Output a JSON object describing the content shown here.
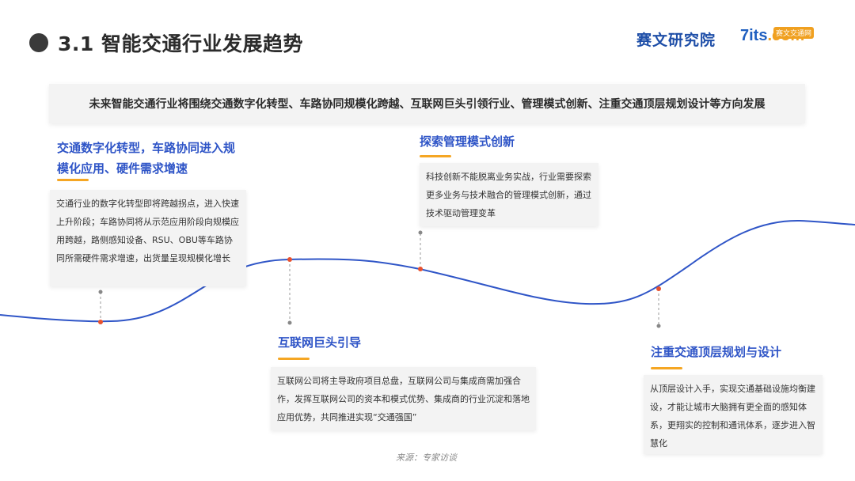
{
  "header": {
    "title": "3.1  智能交通行业发展趋势",
    "logo_left": "赛文研究院",
    "logo_right_main": "7its",
    "logo_right_suffix": ".com",
    "logo_right_badge": "赛文交通网"
  },
  "banner": "未来智能交通行业将围绕交通数字化转型、车路协同规模化跨越、互联网巨头引领行业、管理模式创新、注重交通顶层规划设计等方向发展",
  "trends": [
    {
      "title_line1": "交通数字化转型，车路协同进入规",
      "title_line2": "模化应用、硬件需求增速",
      "body": "交通行业的数字化转型即将跨越拐点，进入快速上升阶段；车路协同将从示范应用阶段向规模应用跨越，路侧感知设备、RSU、OBU等车路协同所需硬件需求增速，出货量呈现规模化增长"
    },
    {
      "title": "互联网巨头引导",
      "body": "互联网公司将主导政府项目总盘，互联网公司与集成商需加强合作，发挥互联网公司的资本和模式优势、集成商的行业沉淀和落地应用优势，共同推进实现“交通强国”"
    },
    {
      "title": "探索管理模式创新",
      "body": "科技创新不能脱离业务实战，行业需要探索更多业务与技术融合的管理模式创新，通过技术驱动管理变革"
    },
    {
      "title": "注重交通顶层规划与设计",
      "body": "从顶层设计入手，实现交通基础设施均衡建设，才能让城市大脑拥有更全面的感知体系，更翔实的控制和通讯体系，逐步进入智慧化"
    }
  ],
  "source": "来源：专家访谈",
  "colors": {
    "curve": "#2f55c7",
    "marker": "#e8522f",
    "heading": "#2f55c7",
    "accent": "#f5a623"
  }
}
